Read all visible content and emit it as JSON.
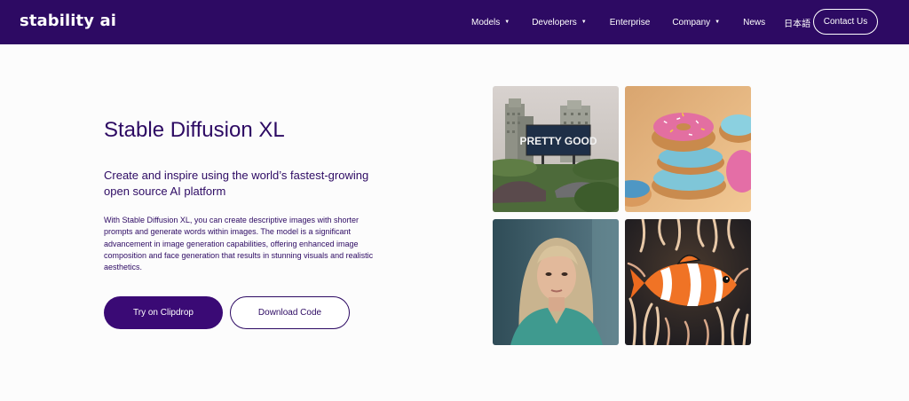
{
  "brand": {
    "logo_text": "stability ai"
  },
  "nav": {
    "items": [
      {
        "label": "Models",
        "has_caret": true
      },
      {
        "label": "Developers",
        "has_caret": true
      },
      {
        "label": "Enterprise",
        "has_caret": false
      },
      {
        "label": "Company",
        "has_caret": true
      },
      {
        "label": "News",
        "has_caret": false
      },
      {
        "label": "日本語",
        "has_caret": false
      }
    ],
    "contact_label": "Contact Us",
    "caret_glyph": "▼"
  },
  "hero": {
    "title": "Stable Diffusion XL",
    "subtitle": "Create and inspire using the world’s fastest-growing open source AI platform",
    "body": "With Stable Diffusion XL, you can create descriptive images with shorter prompts and generate words within images. The model is a significant advancement in image generation capabilities, offering enhanced image composition and face generation that results in stunning visuals and realistic aesthetics.",
    "primary_button": "Try on Clipdrop",
    "secondary_button": "Download Code"
  },
  "gallery": {
    "billboard_text": "PRETTY GOOD"
  },
  "colors": {
    "nav_bg": "#2d0a63",
    "accent": "#3a0a75",
    "page_bg": "#fcfcfc"
  }
}
